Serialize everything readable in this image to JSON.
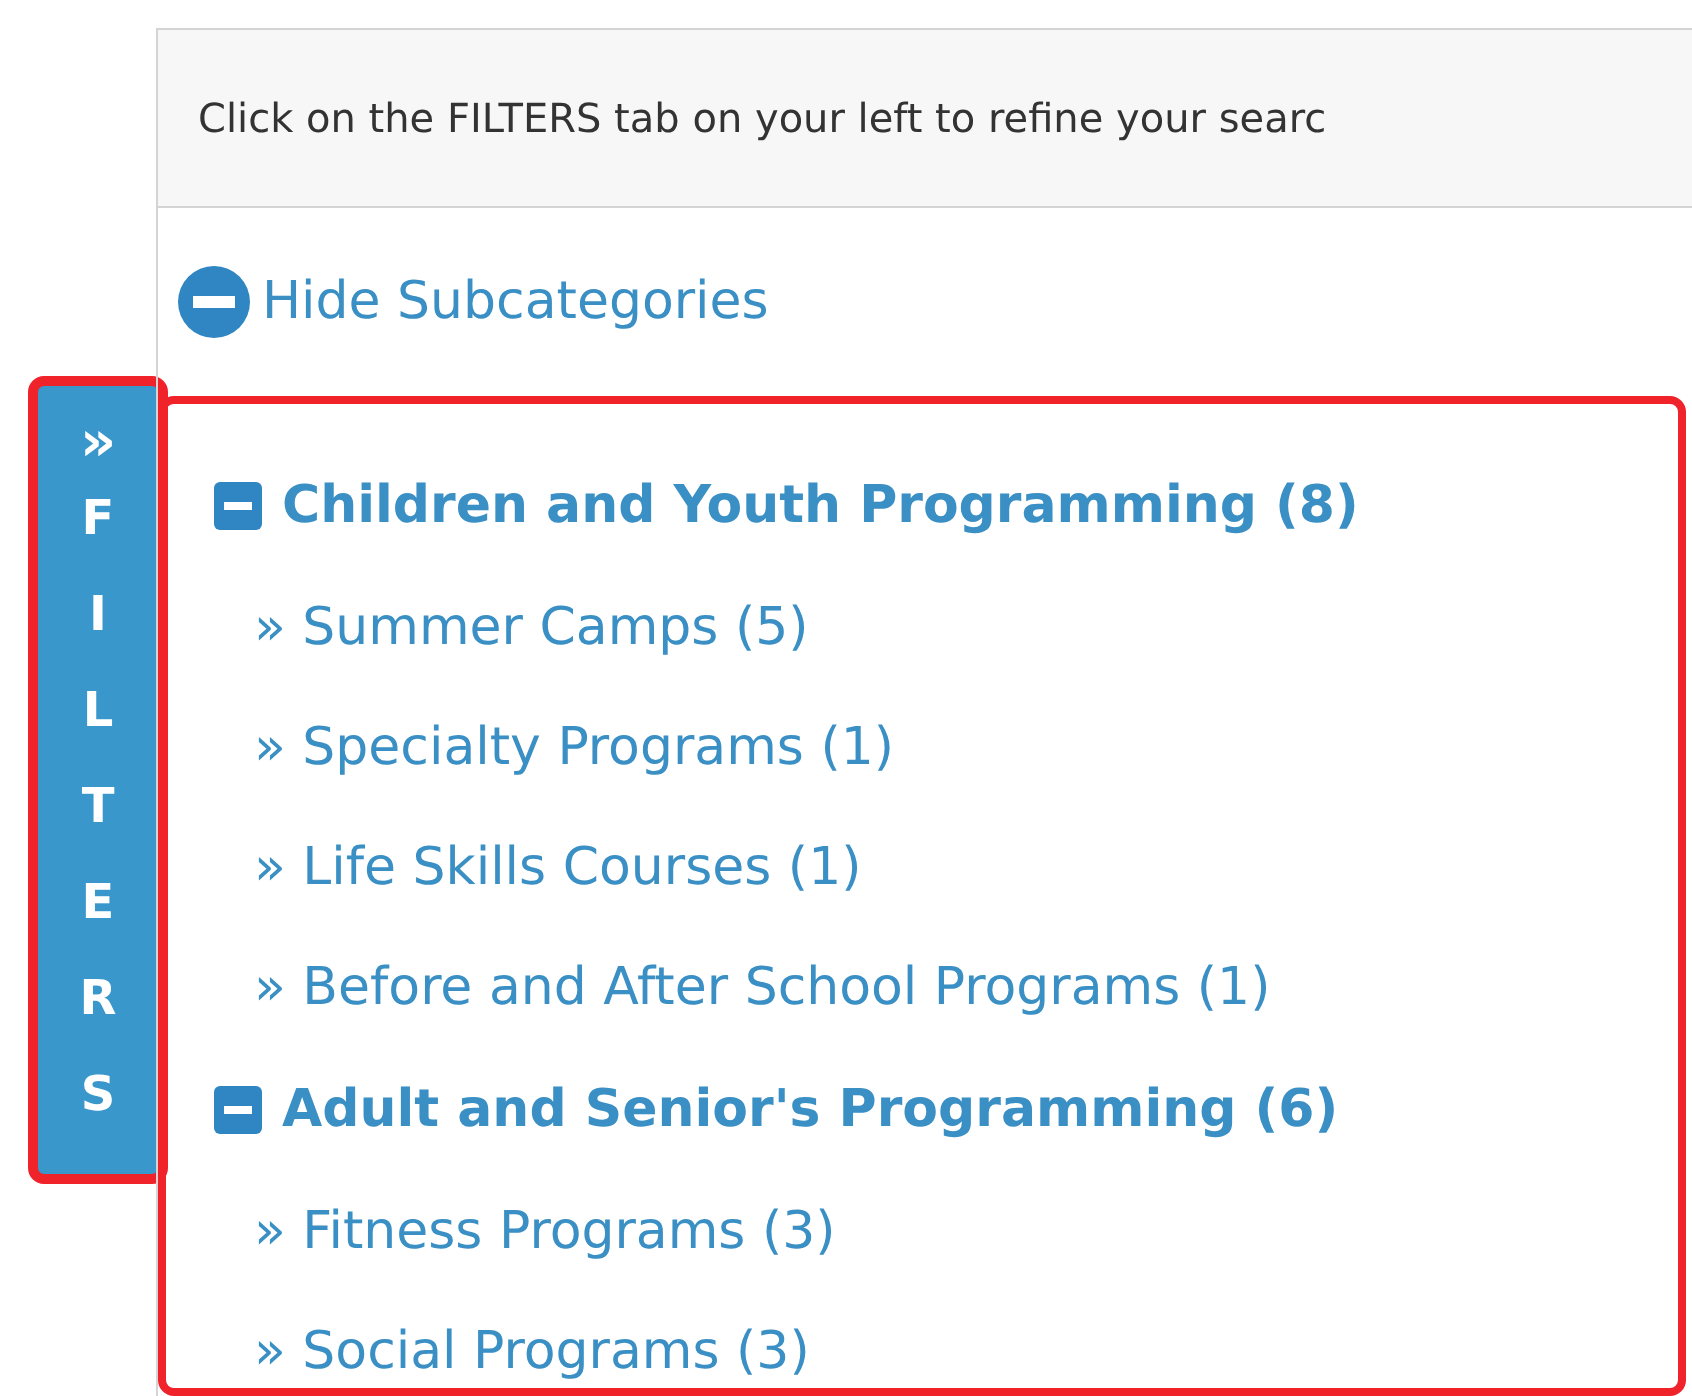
{
  "notice": "Click on the FILTERS tab on your left to refine your searc",
  "toggle": {
    "label": "Hide Subcategories",
    "expanded": true
  },
  "filters_tab": {
    "arrow": "»",
    "letters": "FILTERS",
    "highlighted": true
  },
  "category_list": {
    "highlighted": true
  },
  "categories": [
    {
      "label": "Children and Youth Programming (8)",
      "expanded": true,
      "children": [
        {
          "label": "» Summer Camps (5)"
        },
        {
          "label": "» Specialty Programs (1)"
        },
        {
          "label": "» Life Skills Courses (1)"
        },
        {
          "label": "» Before and After School Programs (1)"
        }
      ]
    },
    {
      "label": "Adult and Senior's Programming (6)",
      "expanded": true,
      "children": [
        {
          "label": "» Fitness Programs (3)"
        },
        {
          "label": "» Social Programs (3)"
        }
      ]
    }
  ]
}
